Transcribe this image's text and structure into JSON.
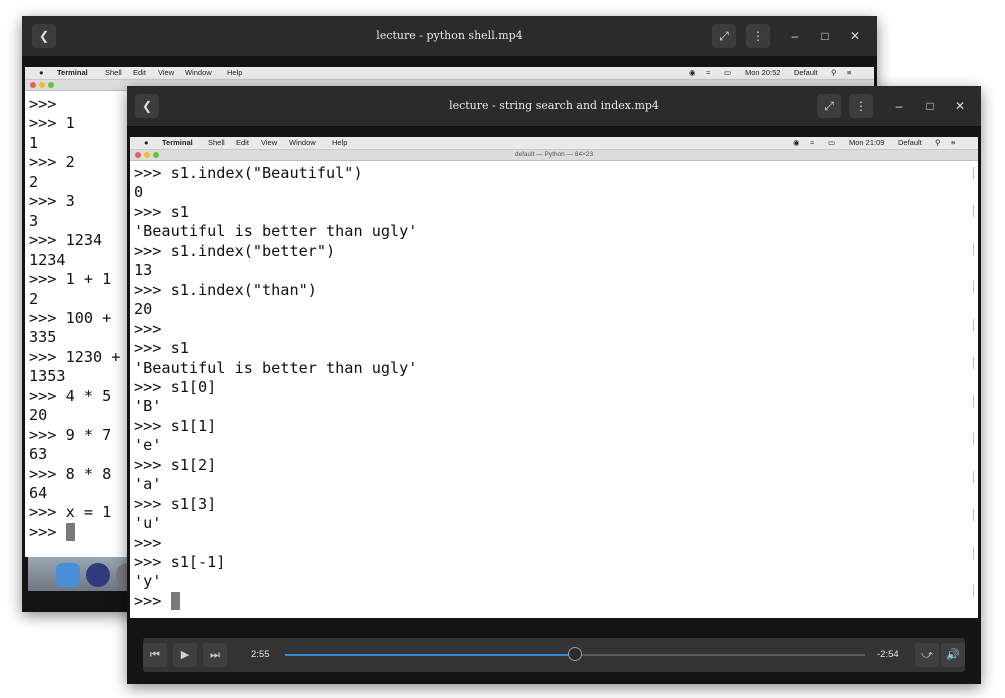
{
  "back_window": {
    "title": "lecture - python shell.mp4",
    "menubar": {
      "app": "Terminal",
      "menus": [
        "Shell",
        "Edit",
        "View",
        "Window",
        "Help"
      ],
      "clock": "Mon 20:52",
      "profile": "Default"
    },
    "lines": [
      ">>>",
      ">>> 1",
      "1",
      ">>> 2",
      "2",
      ">>> 3",
      "3",
      ">>> 1234",
      "1234",
      ">>> 1 + 1",
      "2",
      ">>> 100 +",
      "335",
      ">>> 1230 +",
      "1353",
      ">>> 4 * 5",
      "20",
      ">>> 9 * 7",
      "63",
      ">>> 8 * 8",
      "64",
      ">>> x = 1"
    ],
    "prompt": ">>> "
  },
  "front_window": {
    "title": "lecture - string search and index.mp4",
    "menubar": {
      "app": "Terminal",
      "menus": [
        "Shell",
        "Edit",
        "View",
        "Window",
        "Help"
      ],
      "clock": "Mon 21:09",
      "profile": "Default"
    },
    "terminal_title": "default — Python — 84×23",
    "lines": [
      ">>> s1.index(\"Beautiful\")",
      "0",
      ">>> s1",
      "'Beautiful is better than ugly'",
      ">>> s1.index(\"better\")",
      "13",
      ">>> s1.index(\"than\")",
      "20",
      ">>>",
      ">>> s1",
      "'Beautiful is better than ugly'",
      ">>> s1[0]",
      "'B'",
      ">>> s1[1]",
      "'e'",
      ">>> s1[2]",
      "'a'",
      ">>> s1[3]",
      "'u'",
      ">>>",
      ">>> s1[-1]",
      "'y'"
    ],
    "prompt": ">>> ",
    "player": {
      "elapsed": "2:55",
      "remaining": "-2:54",
      "progress": 0.5
    }
  },
  "icons": {
    "back": "chevron-left-icon",
    "expand": "expand-icon",
    "more": "more-vertical-icon",
    "minimize": "minimize-icon",
    "maximize": "maximize-icon",
    "close": "close-icon",
    "skip_back": "skip-back-icon",
    "play": "play-icon",
    "skip_forward": "skip-forward-icon",
    "replay": "replay-icon",
    "volume": "volume-icon"
  },
  "colors": {
    "title_bar": "#2b2b2b",
    "progress_played": "#2e8bd6",
    "mac_red": "#ec5f57",
    "mac_yellow": "#f6bd2e",
    "mac_green": "#5fc53f"
  }
}
